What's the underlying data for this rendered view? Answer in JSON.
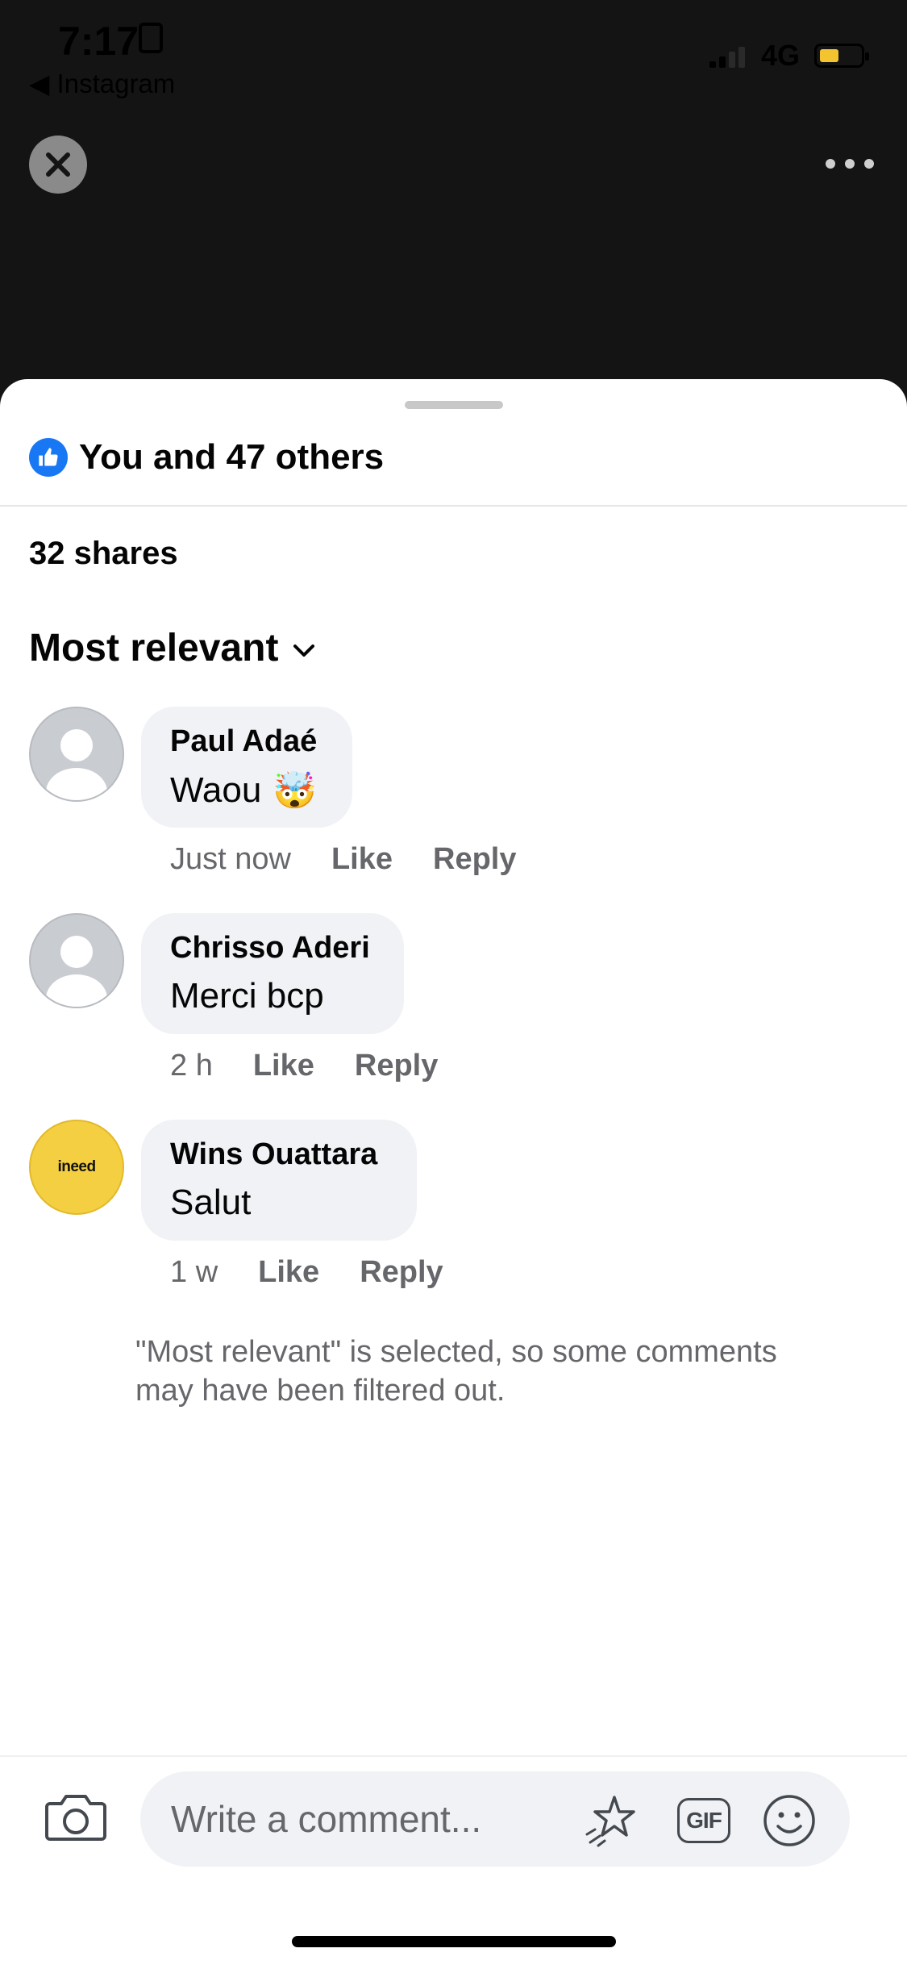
{
  "status_bar": {
    "time": "7:17",
    "back_app": "◀ Instagram",
    "network": "4G",
    "battery_level": 0.45
  },
  "top_bar": {
    "close_icon": "close-icon",
    "more_icon": "more-horizontal-icon"
  },
  "sheet": {
    "reactions_text": "You and 47 others",
    "shares_text": "32 shares",
    "sort_label": "Most relevant",
    "comments": [
      {
        "name": "Paul Adaé",
        "text": "Waou",
        "emoji": "🤯",
        "time": "Just now",
        "like": "Like",
        "reply": "Reply",
        "avatar": "default"
      },
      {
        "name": "Chrisso Aderi",
        "text": "Merci bcp",
        "time": "2 h",
        "like": "Like",
        "reply": "Reply",
        "avatar": "default"
      },
      {
        "name": "Wins Ouattara",
        "text": "Salut",
        "time": "1 w",
        "like": "Like",
        "reply": "Reply",
        "avatar": "brand",
        "avatar_text": "ineed"
      }
    ],
    "filter_note": "\"Most relevant\" is selected, so some comments may have been filtered out."
  },
  "composer": {
    "placeholder": "Write a comment...",
    "gif_label": "GIF",
    "icons": [
      "camera-icon",
      "sparkle-star-icon",
      "gif-icon",
      "emoji-icon"
    ]
  },
  "colors": {
    "accent": "#1877f2",
    "bubble": "#f0f2f5",
    "muted": "#65676b",
    "battery": "#f4c430",
    "brand_avatar": "#f5cf42"
  }
}
